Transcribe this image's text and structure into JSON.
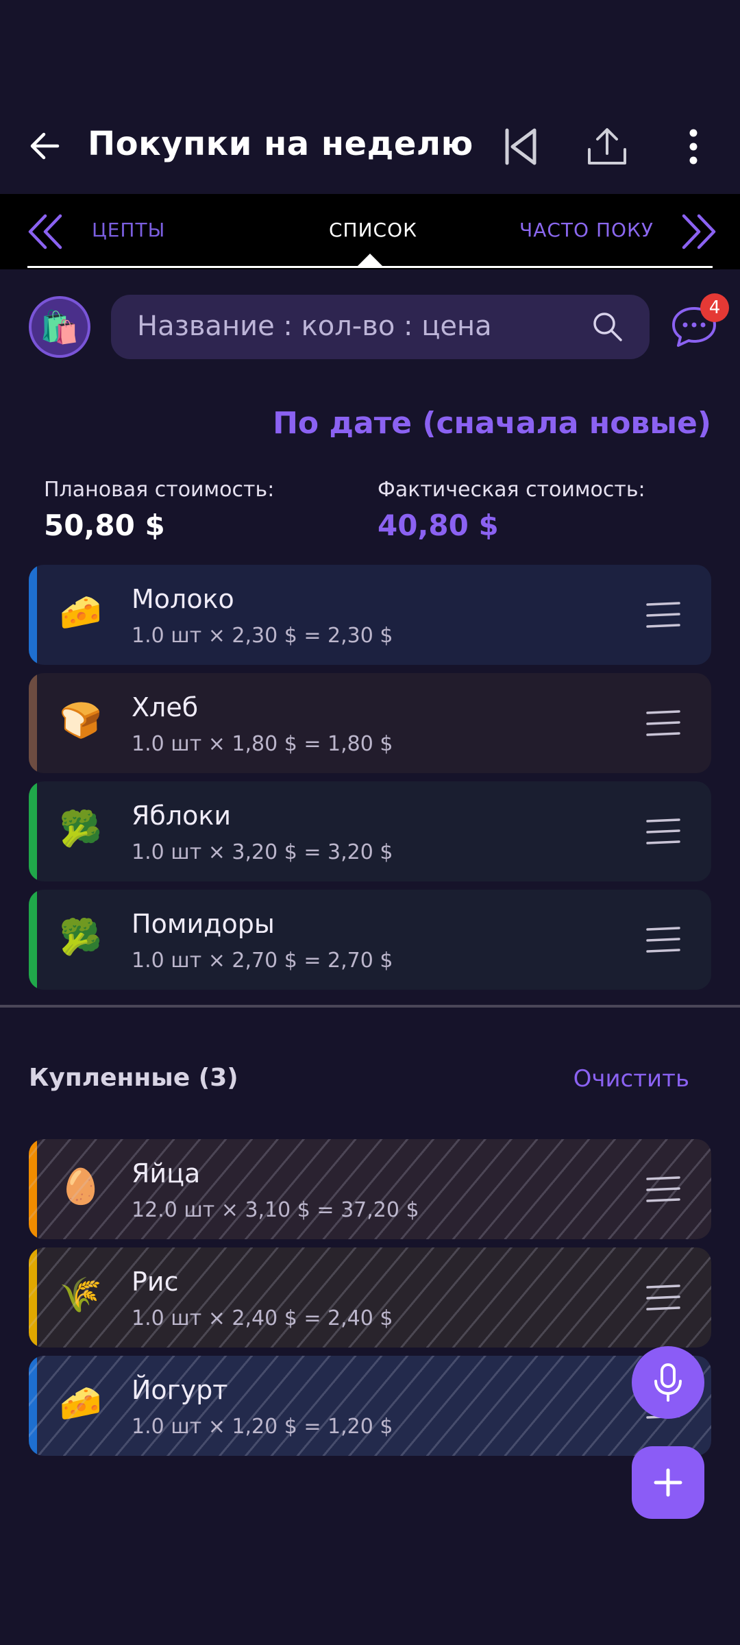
{
  "app_bar": {
    "title": "Покупки на неделю",
    "back_icon": "arrow-left-icon",
    "icons": [
      "skip-to-start-icon",
      "share-icon",
      "more-vertical-icon"
    ]
  },
  "tabs": {
    "left": "ЦЕПТЫ",
    "center": "СПИСОК",
    "right": "ЧАСТО ПОКУПАЕМЫЕ"
  },
  "search": {
    "placeholder": "Название : кол-во : цена"
  },
  "chat": {
    "badge": "4"
  },
  "sort": {
    "label": "По дате (сначала новые)"
  },
  "costs": {
    "planned_label": "Плановая стоимость:",
    "planned_value": "50,80 $",
    "actual_label": "Фактическая стоимость:",
    "actual_value": "40,80 $"
  },
  "items": [
    {
      "name": "Молоко",
      "calc": "1.0 шт × 2,30 $ = 2,30 $",
      "emoji": "🧀",
      "color": "#1e6fd0",
      "bg": "#1c2140"
    },
    {
      "name": "Хлеб",
      "calc": "1.0 шт × 1,80 $ = 1,80 $",
      "emoji": "🍞",
      "color": "#6d4c41",
      "bg": "#221c2c"
    },
    {
      "name": "Яблоки",
      "calc": "1.0 шт × 3,20 $ = 3,20 $",
      "emoji": "🥦",
      "color": "#20a84a",
      "bg": "#1a1e30"
    },
    {
      "name": "Помидоры",
      "calc": "1.0 шт × 2,70 $ = 2,70 $",
      "emoji": "🥦",
      "color": "#20a84a",
      "bg": "#1a1e30"
    }
  ],
  "bought": {
    "header": "Купленные (3)",
    "clear_label": "Очистить",
    "items": [
      {
        "name": "Яйца",
        "calc": "12.0 шт × 3,10 $ = 37,20 $",
        "emoji": "🥚",
        "color": "#f08c00",
        "bg": "#2a2230"
      },
      {
        "name": "Рис",
        "calc": "1.0 шт × 2,40 $ = 2,40 $",
        "emoji": "🌾",
        "color": "#e0a800",
        "bg": "#29242c"
      },
      {
        "name": "Йогурт",
        "calc": "1.0 шт × 1,20 $ = 1,20 $",
        "emoji": "🧀",
        "color": "#1e6fd0",
        "bg": "#232a4c"
      }
    ]
  }
}
